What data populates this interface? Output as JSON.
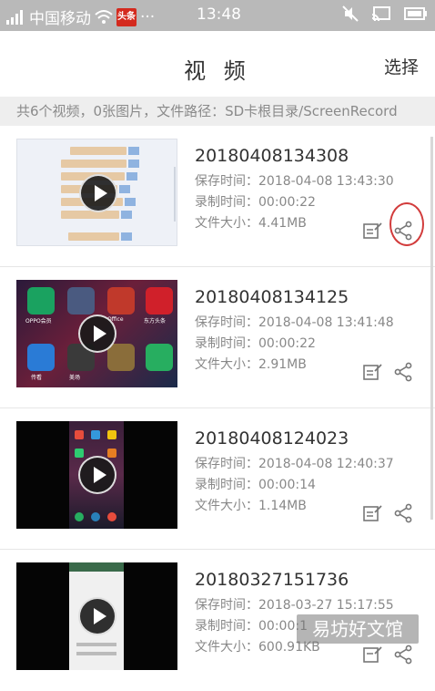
{
  "status_bar": {
    "carrier": "中国移动",
    "app_badge": "头条",
    "dots": "···",
    "time": "13:48"
  },
  "header": {
    "title": "视 频",
    "select_label": "选择"
  },
  "path_bar": {
    "text": "共6个视频，0张图片，文件路径：SD卡根目录/ScreenRecord"
  },
  "meta_labels": {
    "saved": "保存时间：",
    "duration": "录制时间：",
    "size": "文件大小："
  },
  "videos": [
    {
      "name": "20180408134308",
      "saved": "2018-04-08 13:43:30",
      "duration": "00:00:22",
      "size": "4.41MB"
    },
    {
      "name": "20180408134125",
      "saved": "2018-04-08 13:41:48",
      "duration": "00:00:22",
      "size": "2.91MB"
    },
    {
      "name": "20180408124023",
      "saved": "2018-04-08 12:40:37",
      "duration": "00:00:14",
      "size": "1.14MB"
    },
    {
      "name": "20180327151736",
      "saved": "2018-03-27 15:17:55",
      "duration": "00:00:1",
      "size": "600.91KB"
    }
  ],
  "thumb2_labels": [
    "OPPO会员",
    "Office",
    "头条",
    "东方头条",
    "传看",
    "美场"
  ],
  "watermark": "易坊好文馆",
  "colors": {
    "status_bar": "#b9b9b9",
    "path_bar": "#eeeeee",
    "highlight_circle": "#d23c3c",
    "app_badge": "#d42a1e"
  },
  "icons": [
    "signal-icon",
    "wifi-icon",
    "mute-icon",
    "cast-icon",
    "battery-icon",
    "play-icon",
    "edit-icon",
    "share-icon"
  ]
}
